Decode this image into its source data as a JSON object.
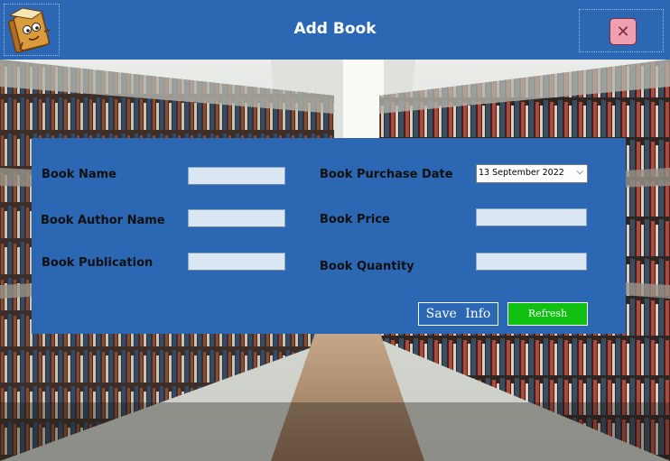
{
  "window": {
    "title": "Add Book"
  },
  "header": {
    "logo_icon": "book-mascot-icon",
    "close_icon": "close-icon"
  },
  "form": {
    "book_name": {
      "label": "Book Name",
      "value": ""
    },
    "author_name": {
      "label": "Book Author Name",
      "value": ""
    },
    "publication": {
      "label": "Book Publication",
      "value": ""
    },
    "purchase_date": {
      "label": "Book Purchase Date",
      "value": "13 September 2022"
    },
    "price": {
      "label": "Book Price",
      "value": ""
    },
    "quantity": {
      "label": "Book Quantity",
      "value": ""
    }
  },
  "buttons": {
    "save": "Save  Info",
    "refresh": "Refresh"
  },
  "colors": {
    "header": "#2b67b3",
    "panel": "#2b67b3",
    "refresh": "#10c010",
    "close": "#f0a0b0"
  }
}
